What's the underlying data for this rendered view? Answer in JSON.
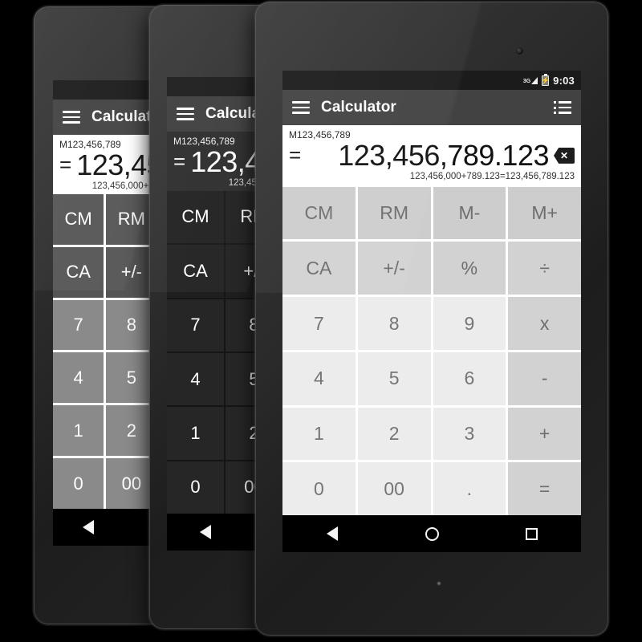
{
  "scene": {
    "background_color": "#000000",
    "device_count": 3,
    "device_type": "android-tablet"
  },
  "status_bar": {
    "network_label": "3G",
    "signal_icon": "signal-triangle-icon",
    "battery_icon": "battery-charging-icon",
    "battery_bolt": "⚡",
    "time": "9:03"
  },
  "action_bar": {
    "menu_icon": "hamburger-menu-icon",
    "title": "Calculator",
    "overflow_icon": "list-menu-icon"
  },
  "display": {
    "memory_label": "M123,456,789",
    "equals_sign": "=",
    "value": "123,456,789.123",
    "sub_expression": "123,456,000+789.123=123,456,789.123",
    "backspace_icon": "backspace-clear-icon",
    "backspace_glyph": "✕"
  },
  "keypad": {
    "rows": [
      [
        {
          "label": "CM",
          "kind": "mem",
          "name": "key-clear-memory"
        },
        {
          "label": "RM",
          "kind": "mem",
          "name": "key-recall-memory"
        },
        {
          "label": "M-",
          "kind": "mem",
          "name": "key-memory-minus"
        },
        {
          "label": "M+",
          "kind": "mem",
          "name": "key-memory-plus"
        }
      ],
      [
        {
          "label": "CA",
          "kind": "fn",
          "name": "key-clear-all"
        },
        {
          "label": "+/-",
          "kind": "fn",
          "name": "key-sign-toggle"
        },
        {
          "label": "%",
          "kind": "fn",
          "name": "key-percent"
        },
        {
          "label": "÷",
          "kind": "op",
          "name": "key-divide"
        }
      ],
      [
        {
          "label": "7",
          "kind": "num",
          "name": "key-7"
        },
        {
          "label": "8",
          "kind": "num",
          "name": "key-8"
        },
        {
          "label": "9",
          "kind": "num",
          "name": "key-9"
        },
        {
          "label": "x",
          "kind": "op",
          "name": "key-multiply"
        }
      ],
      [
        {
          "label": "4",
          "kind": "num",
          "name": "key-4"
        },
        {
          "label": "5",
          "kind": "num",
          "name": "key-5"
        },
        {
          "label": "6",
          "kind": "num",
          "name": "key-6"
        },
        {
          "label": "-",
          "kind": "op",
          "name": "key-minus"
        }
      ],
      [
        {
          "label": "1",
          "kind": "num",
          "name": "key-1"
        },
        {
          "label": "2",
          "kind": "num",
          "name": "key-2"
        },
        {
          "label": "3",
          "kind": "num",
          "name": "key-3"
        },
        {
          "label": "+",
          "kind": "op",
          "name": "key-plus"
        }
      ],
      [
        {
          "label": "0",
          "kind": "num",
          "name": "key-0"
        },
        {
          "label": "00",
          "kind": "num",
          "name": "key-double-zero"
        },
        {
          "label": ".",
          "kind": "num",
          "name": "key-decimal-point"
        },
        {
          "label": "=",
          "kind": "op",
          "name": "key-equals"
        }
      ]
    ]
  },
  "nav_bar": {
    "back_icon": "back-triangle-icon",
    "home_icon": "home-circle-icon",
    "recents_icon": "recents-square-icon"
  },
  "themes": {
    "front": {
      "name": "light-theme",
      "display_bg": "#ffffff",
      "key_bg": "#ececec",
      "accent": "#cdcdcd"
    },
    "middle": {
      "name": "dark-theme",
      "display_bg": "#2b2b2b",
      "key_bg": "#262626",
      "accent": "#1f1f1f"
    },
    "back": {
      "name": "gray-theme",
      "display_bg": "#ffffff",
      "key_bg": "#8a8a8a",
      "accent": "#555555"
    }
  }
}
